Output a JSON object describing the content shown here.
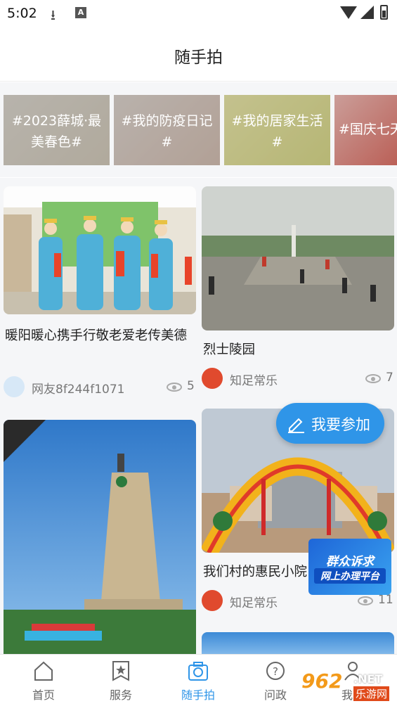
{
  "status_bar": {
    "time": "5:02",
    "notification_icons": [
      "download-icon",
      "a-icon"
    ],
    "system_icons": [
      "wifi-icon",
      "signal-icon",
      "battery-icon"
    ]
  },
  "header": {
    "title": "随手拍"
  },
  "topics": [
    {
      "label": "#2023薛城·最美春色#"
    },
    {
      "label": "#我的防疫日记#"
    },
    {
      "label": "#我的居家生活#"
    },
    {
      "label": "#国庆七天"
    }
  ],
  "posts": [
    {
      "title": "暖阳暖心携手行敬老爱老传美德",
      "author": "网友8f244f1071",
      "views": "5"
    },
    {
      "title": "烈士陵园",
      "author": "知足常乐",
      "views": "7"
    },
    {
      "title": "",
      "author": "",
      "views": ""
    },
    {
      "title": "我们村的惠民小院",
      "author": "知足常乐",
      "views": "11"
    }
  ],
  "join_button": {
    "label": "我要参加"
  },
  "appeal_banner": {
    "line1": "群众诉求",
    "line2": "网上办理平台"
  },
  "tabs": [
    {
      "label": "首页",
      "icon": "home-icon"
    },
    {
      "label": "服务",
      "icon": "service-icon"
    },
    {
      "label": "随手拍",
      "icon": "camera-icon",
      "active": true
    },
    {
      "label": "问政",
      "icon": "question-icon"
    },
    {
      "label": "我的",
      "icon": "user-icon"
    }
  ],
  "watermark": {
    "num": "962",
    "net": ".NET",
    "cn": "乐游网"
  },
  "colors": {
    "accent": "#2f95e8",
    "background": "#f5f6f8"
  }
}
